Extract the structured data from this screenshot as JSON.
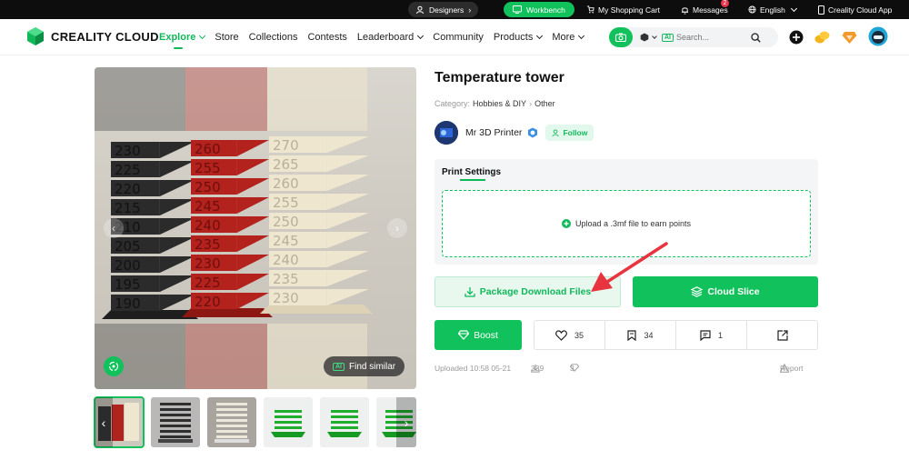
{
  "topbar": {
    "designers": "Designers",
    "workbench": "Workbench",
    "cart": "My Shopping Cart",
    "messages": "Messages",
    "messages_count": "2",
    "language": "English",
    "app": "Creality Cloud App"
  },
  "nav": {
    "brand": "CREALITY CLOUD",
    "menu": [
      "Explore",
      "Store",
      "Collections",
      "Contests",
      "Leaderboard",
      "Community",
      "Products",
      "More"
    ],
    "search_ai": "AI",
    "search_placeholder": "Search..."
  },
  "gallery": {
    "find_similar": "Find similar",
    "find_similar_ai": "AI",
    "tower_labels": {
      "black": [
        "230",
        "225",
        "220",
        "215",
        "210",
        "205",
        "200",
        "195",
        "190"
      ],
      "red": [
        "260",
        "255",
        "250",
        "245",
        "240",
        "235",
        "230",
        "225",
        "220"
      ],
      "white": [
        "270",
        "265",
        "260",
        "255",
        "250",
        "245",
        "240",
        "235",
        "230"
      ]
    }
  },
  "model": {
    "title": "Temperature tower",
    "category_label": "Category:",
    "category": "Hobbies & DIY",
    "subcategory": "Other",
    "author": "Mr 3D Printer",
    "follow": "Follow"
  },
  "print_settings": {
    "heading": "Print Settings",
    "upload_text": "Upload a .3mf file to earn points"
  },
  "actions": {
    "download": "Package Download Files",
    "cloud_slice": "Cloud Slice",
    "boost": "Boost",
    "likes": "35",
    "collects": "34",
    "comments": "1"
  },
  "meta": {
    "uploaded": "Uploaded 10:58 05-21",
    "downloads": "239",
    "boosts": "3",
    "report": "Report"
  },
  "colors": {
    "accent": "#11c15b",
    "annotation_arrow": "#e8343e"
  }
}
